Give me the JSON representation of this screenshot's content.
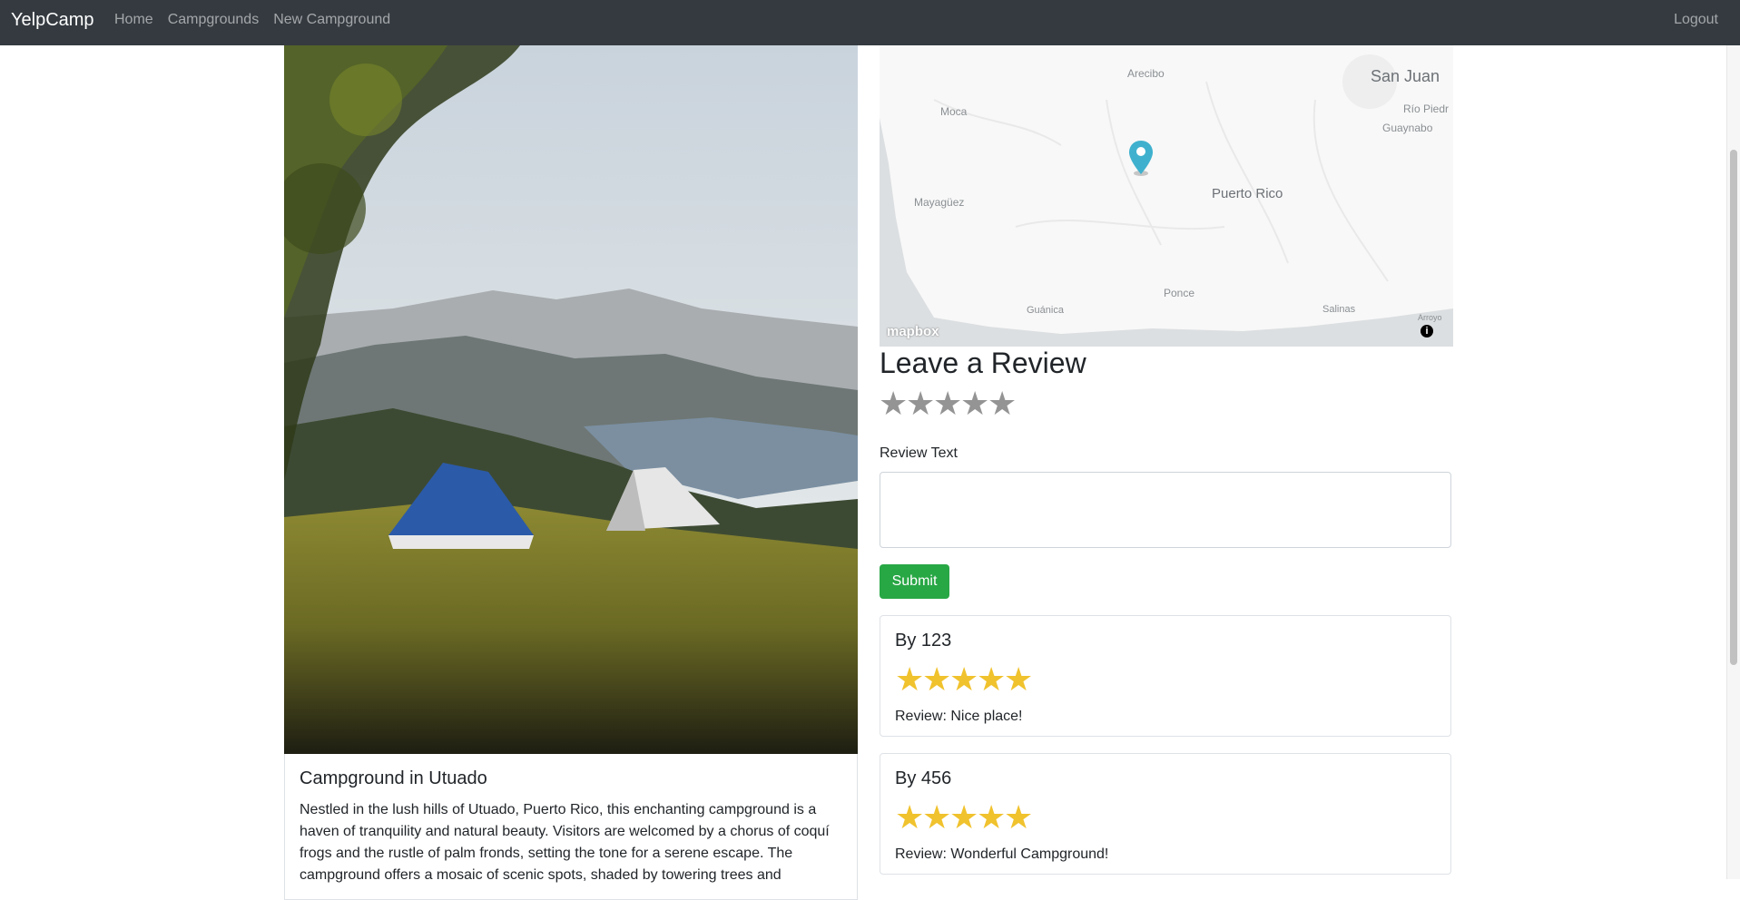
{
  "navbar": {
    "brand": "YelpCamp",
    "links": [
      "Home",
      "Campgrounds",
      "New Campground"
    ],
    "logout": "Logout"
  },
  "campground": {
    "title": "Campground in Utuado",
    "description": "Nestled in the lush hills of Utuado, Puerto Rico, this enchanting campground is a haven of tranquility and natural beauty. Visitors are welcomed by a chorus of coquí frogs and the rustle of palm fronds, setting the tone for a serene escape. The campground offers a mosaic of scenic spots, shaded by towering trees and"
  },
  "map": {
    "labels": {
      "arecibo": "Arecibo",
      "san_juan": "San Juan",
      "rio_piedras": "Río Piedr",
      "guaynabo": "Guaynabo",
      "moca": "Moca",
      "mayaguez": "Mayagüez",
      "puerto_rico": "Puerto Rico",
      "ponce": "Ponce",
      "guanica": "Guánica",
      "salinas": "Salinas",
      "arroyo": "Arroyo"
    },
    "logo": "mapbox",
    "info_icon": "info-icon",
    "marker_icon": "map-pin-icon",
    "marker_color": "#3fb1ce"
  },
  "review_form": {
    "heading": "Leave a Review",
    "rating_count": 5,
    "text_label": "Review Text",
    "submit_label": "Submit"
  },
  "reviews": [
    {
      "author": "By 123",
      "rating": 5,
      "text": "Review: Nice place!"
    },
    {
      "author": "By 456",
      "rating": 5,
      "text": "Review: Wonderful Campground!"
    }
  ],
  "colors": {
    "navbar": "#343a40",
    "submit": "#28a745",
    "star_filled": "#f0c22d",
    "star_empty": "#949494"
  }
}
